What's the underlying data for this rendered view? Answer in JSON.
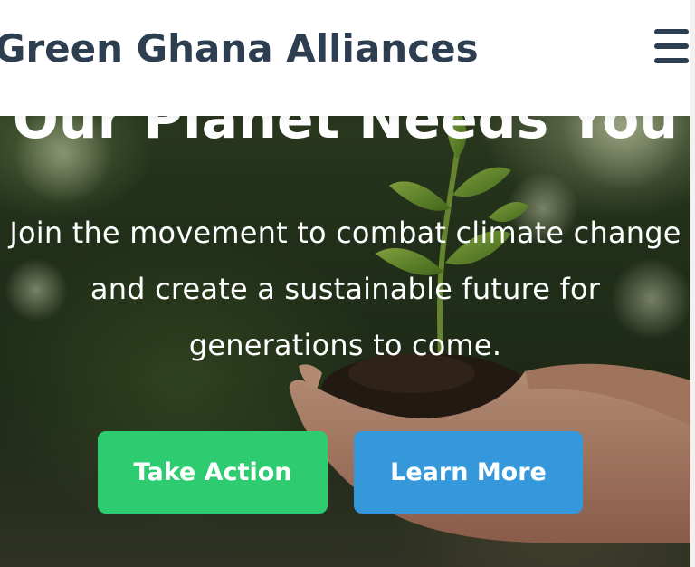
{
  "header": {
    "brand": "Green Ghana Alliances",
    "menu_icon": "hamburger-menu-icon"
  },
  "hero": {
    "title": "Our Planet Needs You",
    "subtitle": "Join the movement to combat climate change and create a sustainable future for generations to come.",
    "primary_button": "Take Action",
    "secondary_button": "Learn More",
    "background_image": "seedling-in-hands-photo"
  },
  "colors": {
    "brand_text": "#2c3e50",
    "primary_button": "#2ecc71",
    "secondary_button": "#3498db",
    "hero_text": "#ffffff"
  }
}
